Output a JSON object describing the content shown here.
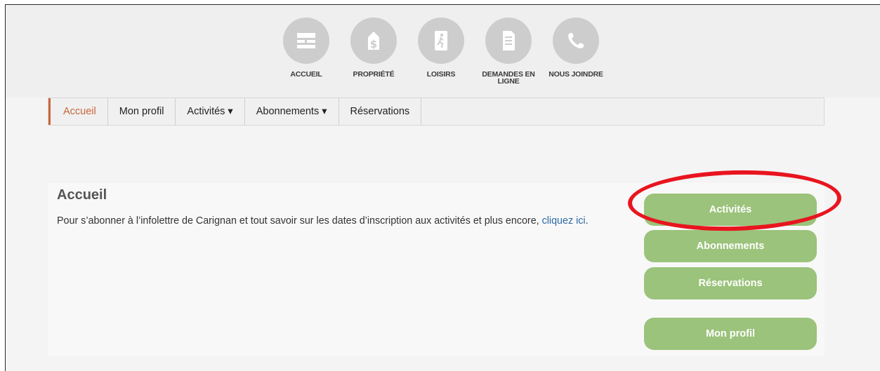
{
  "icon_nav": [
    {
      "label": "ACCUEIL",
      "icon": "home-grid-icon"
    },
    {
      "label": "PROPRIÉTÉ",
      "icon": "property-tag-icon"
    },
    {
      "label": "LOISIRS",
      "icon": "leisure-icon"
    },
    {
      "label": "DEMANDES EN LIGNE",
      "icon": "document-icon"
    },
    {
      "label": "NOUS JOINDRE",
      "icon": "phone-icon"
    }
  ],
  "menu": [
    {
      "label": "Accueil",
      "active": true
    },
    {
      "label": "Mon profil"
    },
    {
      "label": "Activités ▾"
    },
    {
      "label": "Abonnements ▾"
    },
    {
      "label": "Réservations"
    }
  ],
  "main": {
    "title": "Accueil",
    "text": "Pour s’abonner à l’infolettre de Carignan et tout savoir sur les dates d’inscription aux activités et plus encore, ",
    "link": "cliquez ici",
    "text_end": "."
  },
  "side_buttons": {
    "activites": "Activités",
    "abonnements": "Abonnements",
    "reservations": "Réservations",
    "mon_profil": "Mon profil"
  },
  "colors": {
    "accent": "#c8663a",
    "button_green": "#9bc37b",
    "link": "#2d6aa6",
    "highlight": "#e8151f"
  }
}
